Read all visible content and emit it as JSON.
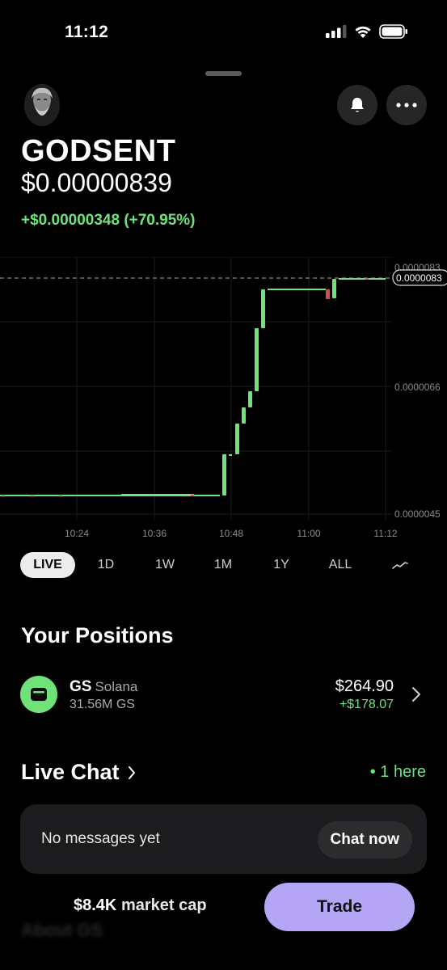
{
  "status_bar": {
    "time": "11:12"
  },
  "token": {
    "name": "GODSENT",
    "price": "$0.00000839",
    "change": "+$0.00000348 (+70.95%)"
  },
  "chart": {
    "y_tick_labels": [
      "0.0000083",
      "0.0000066",
      "0.0000045"
    ],
    "current_price_label": "0.0000083",
    "x_tick_labels": [
      "10:24",
      "10:36",
      "10:48",
      "11:00",
      "11:12"
    ],
    "up_color": "#6fe27a",
    "down_color": "#e04a4a"
  },
  "ranges": {
    "items": [
      "LIVE",
      "1D",
      "1W",
      "1M",
      "1Y",
      "ALL"
    ],
    "active": "LIVE",
    "chart_style_icon": "line-chart-icon"
  },
  "positions": {
    "title": "Your Positions",
    "items": [
      {
        "ticker": "GS",
        "chain": "Solana",
        "amount": "31.56M GS",
        "value": "$264.90",
        "pnl": "+$178.07"
      }
    ]
  },
  "live_chat": {
    "title": "Live Chat",
    "here": "• 1 here",
    "empty_text": "No messages yet",
    "cta": "Chat now"
  },
  "footer": {
    "market_cap_value": "$8.4K",
    "market_cap_label": "market cap",
    "trade_label": "Trade",
    "about_label": "About GS"
  }
}
